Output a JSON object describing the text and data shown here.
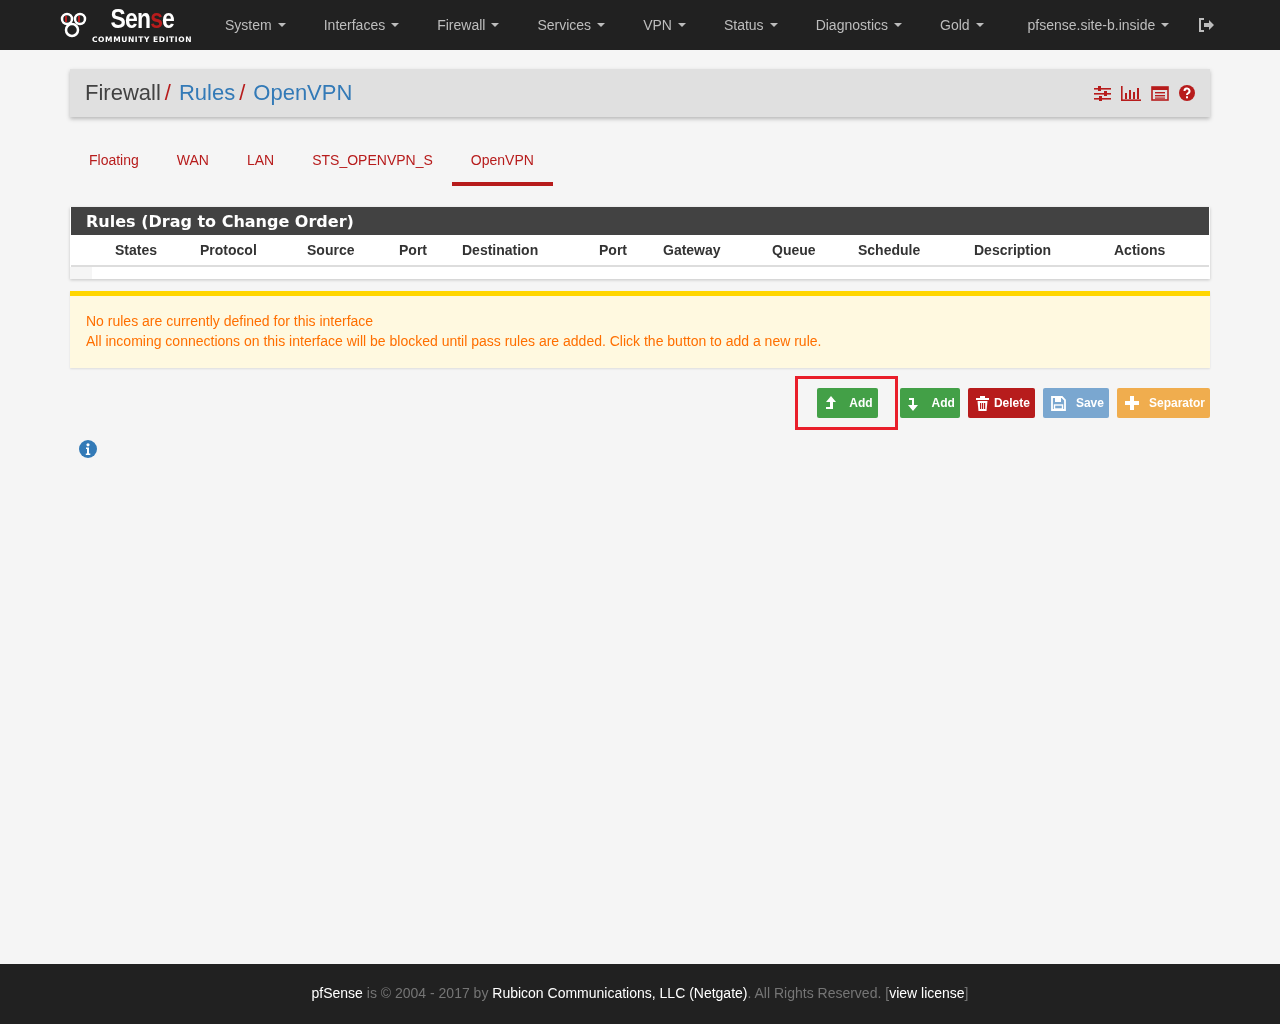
{
  "navbar": {
    "logo": {
      "wordmark": "Sense",
      "edition": "COMMUNITY EDITION"
    },
    "menus": [
      {
        "label": "System"
      },
      {
        "label": "Interfaces"
      },
      {
        "label": "Firewall"
      },
      {
        "label": "Services"
      },
      {
        "label": "VPN"
      },
      {
        "label": "Status"
      },
      {
        "label": "Diagnostics"
      },
      {
        "label": "Gold"
      },
      {
        "label": "pfsense.site-b.inside"
      }
    ]
  },
  "breadcrumb": [
    {
      "label": "Firewall",
      "link": false,
      "separator": "/"
    },
    {
      "label": "Rules",
      "link": true,
      "separator": "/"
    },
    {
      "label": "OpenVPN",
      "link": true
    }
  ],
  "tabs": [
    {
      "label": "Floating",
      "selected": false
    },
    {
      "label": "WAN",
      "selected": false
    },
    {
      "label": "LAN",
      "selected": false
    },
    {
      "label": "STS_OPENVPN_S",
      "selected": false
    },
    {
      "label": "OpenVPN",
      "selected": true
    }
  ],
  "rules_panel": {
    "title": "Rules (Drag to Change Order)",
    "columns": [
      "States",
      "Protocol",
      "Source",
      "Port",
      "Destination",
      "Port",
      "Gateway",
      "Queue",
      "Schedule",
      "Description",
      "Actions"
    ]
  },
  "alert": {
    "lines": [
      "No rules are currently defined for this interface",
      "All incoming connections on this interface will be blocked until pass rules are added. Click the button to add a new rule."
    ]
  },
  "buttons": [
    {
      "kind": "add-top",
      "label": "Add",
      "highlighted": true
    },
    {
      "kind": "add-bottom",
      "label": "Add",
      "highlighted": false
    },
    {
      "kind": "delete",
      "label": "Delete",
      "highlighted": false
    },
    {
      "kind": "save",
      "label": "Save",
      "highlighted": false
    },
    {
      "kind": "separator",
      "label": "Separator",
      "highlighted": false
    }
  ],
  "footer": {
    "text": "**pfSense** is © 2004 - 2017 by **Rubicon Communications, LLC (Netgate)**. All Rights Reserved. [",
    "link": "view license",
    "end": "]"
  }
}
